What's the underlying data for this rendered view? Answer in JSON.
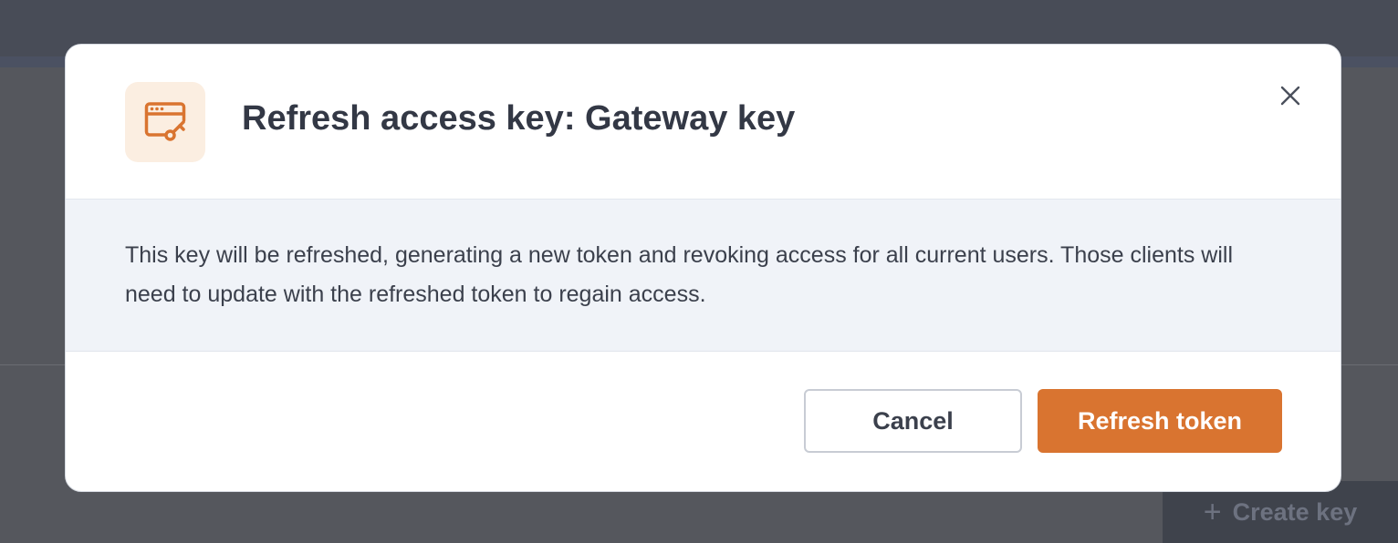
{
  "background": {
    "create_key_label": "Create key",
    "create_key_icon": "plus-icon"
  },
  "modal": {
    "icon": "browser-key-icon",
    "title": "Refresh access key: Gateway key",
    "close_icon": "close-icon",
    "message": "This key will be refreshed, generating a new token and revoking access for all current users. Those clients will need to update with the refreshed token to regain access.",
    "cancel_label": "Cancel",
    "confirm_label": "Refresh token"
  },
  "colors": {
    "accent": "#d97430",
    "accent_bg": "#fbeee1",
    "body_bg": "#f0f3f8",
    "overlay": "#55575d",
    "text": "#333845"
  }
}
